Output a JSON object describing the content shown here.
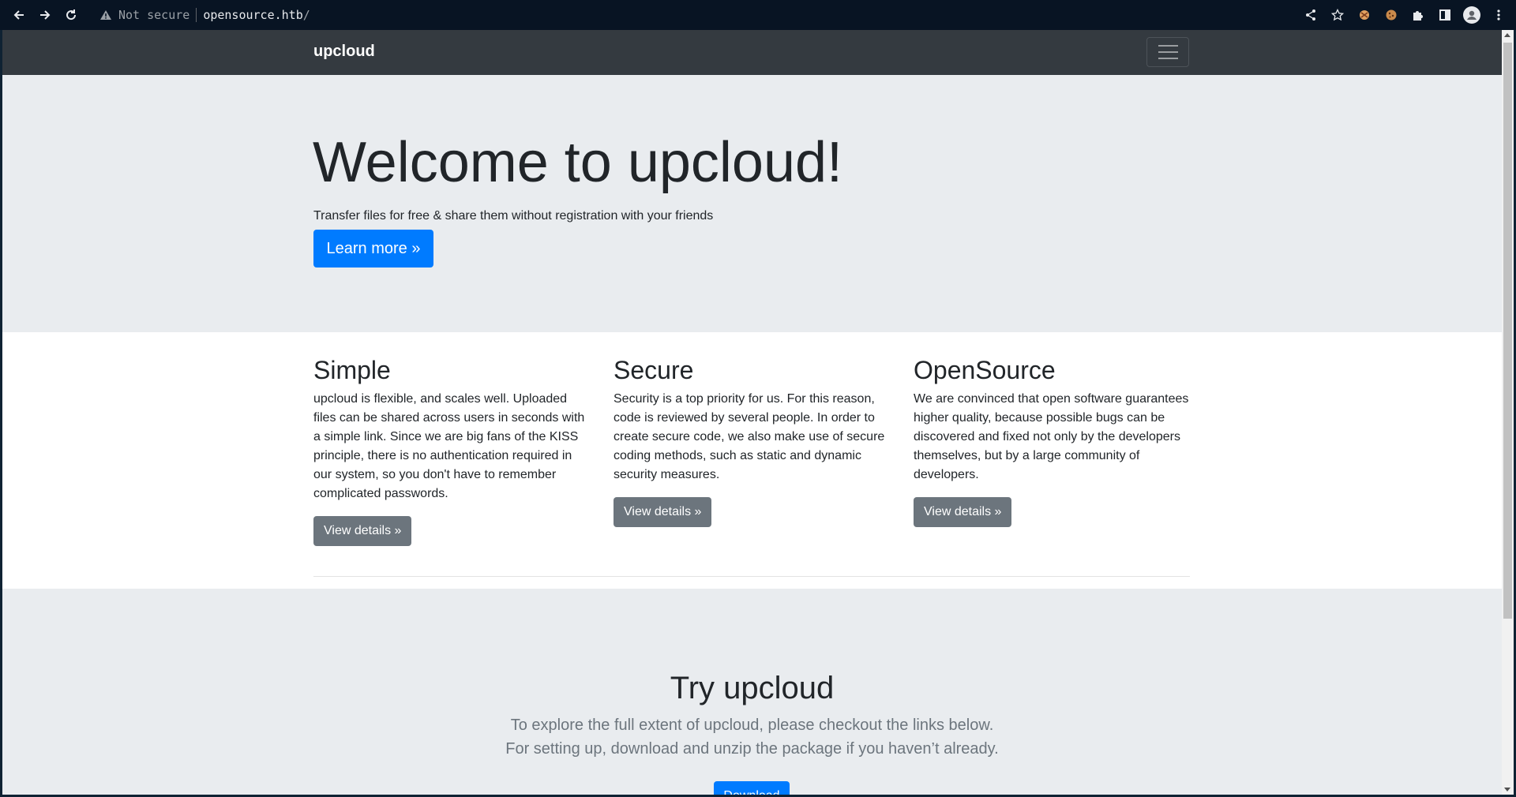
{
  "browser": {
    "security_label": "Not secure",
    "url_host": "opensource.htb",
    "url_path": "/"
  },
  "navbar": {
    "brand": "upcloud"
  },
  "jumbotron": {
    "title": "Welcome to upcloud!",
    "subtitle": "Transfer files for free & share them without registration with your friends",
    "button": "Learn more »"
  },
  "features": [
    {
      "title": "Simple",
      "text": "upcloud is flexible, and scales well. Uploaded files can be shared across users in seconds with a simple link. Since we are big fans of the KISS principle, there is no authentication required in our system, so you don't have to remember complicated passwords.",
      "button": "View details »"
    },
    {
      "title": "Secure",
      "text": "Security is a top priority for us. For this reason, code is reviewed by several people. In order to create secure code, we also make use of secure coding methods, such as static and dynamic security measures.",
      "button": "View details »"
    },
    {
      "title": "OpenSource",
      "text": "We are convinced that open software guarantees higher quality, because possible bugs can be discovered and fixed not only by the developers themselves, but by a large community of developers.",
      "button": "View details »"
    }
  ],
  "try": {
    "title": "Try upcloud",
    "line1": "To explore the full extent of upcloud, please checkout the links below.",
    "line2": "For setting up, download and unzip the package if you haven’t already.",
    "button": "Download"
  },
  "colors": {
    "primary": "#007bff",
    "secondary": "#6c757d",
    "navbar": "#343a40",
    "jumbotron": "#e9ecef"
  }
}
